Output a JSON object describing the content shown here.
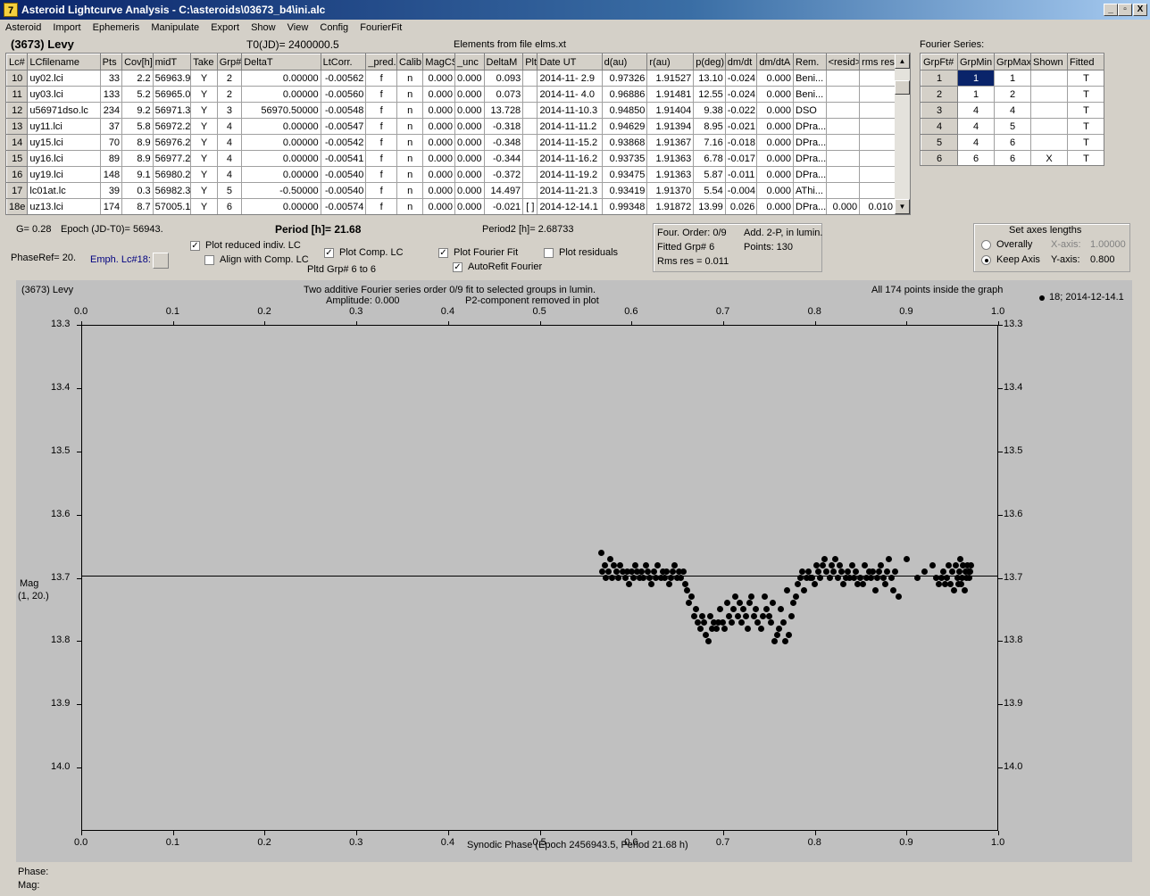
{
  "window": {
    "title": "Asteroid Lightcurve Analysis - C:\\asteroids\\03673_b4\\ini.alc",
    "app_icon": "7",
    "buttons": [
      "_",
      "▫",
      "X"
    ]
  },
  "menu": [
    "Asteroid",
    "Import",
    "Ephemeris",
    "Manipulate",
    "Export",
    "Show",
    "View",
    "Config",
    "FourierFit"
  ],
  "header": {
    "asteroid": "(3673) Levy",
    "t0": "T0(JD)= 2400000.5",
    "elements": "Elements from file elms.xt",
    "fourier_series_label": "Fourier Series:"
  },
  "lc_table": {
    "columns": [
      "Lc#",
      "LCfilename",
      "Pts",
      "Cov[h]",
      "midT",
      "Take",
      "Grp#",
      "DeltaT",
      "LtCorr.",
      "_pred.",
      "Calib.",
      "MagCS",
      "_unc",
      "DeltaM",
      "Plt",
      "Date UT",
      "d(au)",
      "r(au)",
      "p(deg)",
      "dm/dt",
      "dm/dtA",
      "Rem.",
      "<resid>",
      "rms res"
    ],
    "rows": [
      [
        "10",
        "uy02.lci",
        "33",
        "2.2",
        "56963.9",
        "Y",
        "2",
        "0.00000",
        "-0.00562",
        "f",
        "n",
        "0.000",
        "0.000",
        "0.093",
        "",
        "2014-11- 2.9",
        "0.97326",
        "1.91527",
        "13.10",
        "-0.024",
        "0.000",
        "Beni...",
        "",
        ""
      ],
      [
        "11",
        "uy03.lci",
        "133",
        "5.2",
        "56965.0",
        "Y",
        "2",
        "0.00000",
        "-0.00560",
        "f",
        "n",
        "0.000",
        "0.000",
        "0.073",
        "",
        "2014-11- 4.0",
        "0.96886",
        "1.91481",
        "12.55",
        "-0.024",
        "0.000",
        "Beni...",
        "",
        ""
      ],
      [
        "12",
        "u56971dso.lc",
        "234",
        "9.2",
        "56971.3",
        "Y",
        "3",
        "56970.50000",
        "-0.00548",
        "f",
        "n",
        "0.000",
        "0.000",
        "13.728",
        "",
        "2014-11-10.3",
        "0.94850",
        "1.91404",
        "9.38",
        "-0.022",
        "0.000",
        "DSO",
        "",
        ""
      ],
      [
        "13",
        "uy11.lci",
        "37",
        "5.8",
        "56972.2",
        "Y",
        "4",
        "0.00000",
        "-0.00547",
        "f",
        "n",
        "0.000",
        "0.000",
        "-0.318",
        "",
        "2014-11-11.2",
        "0.94629",
        "1.91394",
        "8.95",
        "-0.021",
        "0.000",
        "DPra...",
        "",
        ""
      ],
      [
        "14",
        "uy15.lci",
        "70",
        "8.9",
        "56976.2",
        "Y",
        "4",
        "0.00000",
        "-0.00542",
        "f",
        "n",
        "0.000",
        "0.000",
        "-0.348",
        "",
        "2014-11-15.2",
        "0.93868",
        "1.91367",
        "7.16",
        "-0.018",
        "0.000",
        "DPra...",
        "",
        ""
      ],
      [
        "15",
        "uy16.lci",
        "89",
        "8.9",
        "56977.2",
        "Y",
        "4",
        "0.00000",
        "-0.00541",
        "f",
        "n",
        "0.000",
        "0.000",
        "-0.344",
        "",
        "2014-11-16.2",
        "0.93735",
        "1.91363",
        "6.78",
        "-0.017",
        "0.000",
        "DPra...",
        "",
        ""
      ],
      [
        "16",
        "uy19.lci",
        "148",
        "9.1",
        "56980.2",
        "Y",
        "4",
        "0.00000",
        "-0.00540",
        "f",
        "n",
        "0.000",
        "0.000",
        "-0.372",
        "",
        "2014-11-19.2",
        "0.93475",
        "1.91363",
        "5.87",
        "-0.011",
        "0.000",
        "DPra...",
        "",
        ""
      ],
      [
        "17",
        "lc01at.lc",
        "39",
        "0.3",
        "56982.3",
        "Y",
        "5",
        "-0.50000",
        "-0.00540",
        "f",
        "n",
        "0.000",
        "0.000",
        "14.497",
        "",
        "2014-11-21.3",
        "0.93419",
        "1.91370",
        "5.54",
        "-0.004",
        "0.000",
        "AThi...",
        "",
        ""
      ],
      [
        "18e",
        "uz13.lci",
        "174",
        "8.7",
        "57005.1",
        "Y",
        "6",
        "0.00000",
        "-0.00574",
        "f",
        "n",
        "0.000",
        "0.000",
        "-0.021",
        "[ ]",
        "2014-12-14.1",
        "0.99348",
        "1.91872",
        "13.99",
        "0.026",
        "0.000",
        "DPra...",
        "0.000",
        "0.010"
      ]
    ]
  },
  "fourier_table": {
    "columns": [
      "GrpFt#",
      "GrpMin",
      "GrpMax",
      "Shown",
      "Fitted"
    ],
    "rows": [
      [
        "1",
        "1",
        "1",
        "",
        "T"
      ],
      [
        "2",
        "1",
        "2",
        "",
        "T"
      ],
      [
        "3",
        "4",
        "4",
        "",
        "T"
      ],
      [
        "4",
        "4",
        "5",
        "",
        "T"
      ],
      [
        "5",
        "4",
        "6",
        "",
        "T"
      ],
      [
        "6",
        "6",
        "6",
        "X",
        "T"
      ]
    ]
  },
  "controls": {
    "g": "G= 0.28",
    "epoch": "Epoch (JD-T0)= 56943.",
    "period": "Period [h]= 21.68",
    "period2": "Period2 [h]= 2.68733",
    "phaseref": "PhaseRef= 20.",
    "emph": "Emph. Lc#18:",
    "plot_reduced": "Plot reduced indiv. LC",
    "align_comp": "Align with Comp. LC",
    "plot_comp": "Plot Comp. LC",
    "pltd_grp": "Pltd Grp#  6  to   6",
    "plot_fourier": "Plot Fourier Fit",
    "autorefit": "AutoRefit Fourier",
    "plot_residuals": "Plot residuals",
    "check_state": {
      "plot_reduced": true,
      "align_comp": false,
      "plot_comp": true,
      "plot_fourier": true,
      "autorefit": true,
      "plot_residuals": false
    },
    "four_order": "Four. Order:  0/9",
    "add_2p": "Add. 2-P, in lumin.",
    "fitted_grp": "Fitted Grp# 6",
    "points": "Points: 130",
    "rms_res": "Rms res     = 0.011",
    "axes_title": "Set axes lengths",
    "overally": "Overally",
    "keep_axis": "Keep Axis",
    "x_axis_label": "X-axis:",
    "x_axis_val": "1.00000",
    "y_axis_label": "Y-axis:",
    "y_axis_val": "0.800",
    "axes_mode": "keep_axis"
  },
  "plot_header": {
    "name": "(3673) Levy",
    "line1": "Two additive Fourier series order 0/9 fit to selected groups in lumin.",
    "line2": "Amplitude: 0.000",
    "line3": "P2-component removed in plot",
    "inside": "All 174 points inside the graph",
    "legend": "18; 2014-12-14.1"
  },
  "chart_data": {
    "type": "scatter",
    "title": "Two additive Fourier series order 0/9 fit to selected groups in lumin.",
    "xlabel": "Synodic Phase (Epoch 2456943.5, Period 21.68 h)",
    "ylabel": "Mag\n(1, 20.)",
    "ylabel_line1": "Mag",
    "ylabel_line2": "(1, 20.)",
    "xlim": [
      0.0,
      1.0
    ],
    "ylim": [
      13.3,
      14.1
    ],
    "y_inverted": true,
    "x_ticks": [
      "0.0",
      "0.1",
      "0.2",
      "0.3",
      "0.4",
      "0.5",
      "0.6",
      "0.7",
      "0.8",
      "0.9",
      "1.0"
    ],
    "y_ticks": [
      "13.3",
      "13.4",
      "13.5",
      "13.6",
      "13.7",
      "13.8",
      "13.9",
      "14.0"
    ],
    "fit_line": 13.696,
    "legend": "top-right",
    "series": [
      {
        "name": "18; 2014-12-14.1",
        "x": [
          0.567,
          0.568,
          0.571,
          0.572,
          0.575,
          0.577,
          0.579,
          0.581,
          0.584,
          0.586,
          0.588,
          0.591,
          0.593,
          0.595,
          0.597,
          0.6,
          0.602,
          0.604,
          0.606,
          0.609,
          0.611,
          0.613,
          0.616,
          0.618,
          0.62,
          0.622,
          0.625,
          0.627,
          0.629,
          0.632,
          0.634,
          0.636,
          0.638,
          0.641,
          0.643,
          0.645,
          0.647,
          0.65,
          0.652,
          0.654,
          0.657,
          0.659,
          0.661,
          0.663,
          0.666,
          0.668,
          0.67,
          0.672,
          0.675,
          0.677,
          0.679,
          0.681,
          0.684,
          0.686,
          0.688,
          0.69,
          0.693,
          0.695,
          0.697,
          0.7,
          0.702,
          0.704,
          0.706,
          0.709,
          0.711,
          0.713,
          0.716,
          0.718,
          0.72,
          0.722,
          0.725,
          0.727,
          0.729,
          0.731,
          0.734,
          0.736,
          0.738,
          0.741,
          0.743,
          0.745,
          0.747,
          0.75,
          0.752,
          0.754,
          0.756,
          0.759,
          0.761,
          0.763,
          0.766,
          0.768,
          0.77,
          0.772,
          0.775,
          0.777,
          0.779,
          0.781,
          0.784,
          0.786,
          0.788,
          0.791,
          0.793,
          0.795,
          0.797,
          0.8,
          0.802,
          0.804,
          0.806,
          0.809,
          0.811,
          0.813,
          0.816,
          0.818,
          0.82,
          0.822,
          0.825,
          0.827,
          0.829,
          0.831,
          0.834,
          0.836,
          0.838,
          0.841,
          0.843,
          0.845,
          0.847,
          0.85,
          0.852,
          0.854,
          0.856,
          0.859,
          0.861,
          0.863,
          0.866,
          0.868,
          0.87,
          0.872,
          0.875,
          0.877,
          0.879,
          0.881,
          0.884,
          0.886,
          0.888,
          0.891,
          0.9,
          0.912,
          0.92,
          0.928,
          0.932,
          0.935,
          0.938,
          0.94,
          0.942,
          0.944,
          0.946,
          0.948,
          0.95,
          0.952,
          0.954,
          0.956,
          0.957,
          0.958,
          0.959,
          0.96,
          0.961,
          0.962,
          0.963,
          0.964,
          0.965,
          0.966,
          0.967,
          0.968,
          0.969,
          0.97
        ],
        "y": [
          13.66,
          13.69,
          13.68,
          13.7,
          13.69,
          13.67,
          13.7,
          13.68,
          13.69,
          13.7,
          13.68,
          13.69,
          13.7,
          13.69,
          13.71,
          13.69,
          13.7,
          13.68,
          13.69,
          13.7,
          13.69,
          13.7,
          13.68,
          13.69,
          13.7,
          13.71,
          13.69,
          13.7,
          13.68,
          13.7,
          13.69,
          13.7,
          13.69,
          13.71,
          13.7,
          13.69,
          13.68,
          13.7,
          13.69,
          13.7,
          13.69,
          13.71,
          13.72,
          13.74,
          13.73,
          13.76,
          13.75,
          13.77,
          13.78,
          13.76,
          13.77,
          13.79,
          13.8,
          13.76,
          13.78,
          13.77,
          13.78,
          13.77,
          13.75,
          13.77,
          13.78,
          13.74,
          13.76,
          13.77,
          13.75,
          13.73,
          13.76,
          13.74,
          13.77,
          13.75,
          13.76,
          13.78,
          13.74,
          13.73,
          13.76,
          13.75,
          13.77,
          13.78,
          13.76,
          13.73,
          13.75,
          13.76,
          13.77,
          13.74,
          13.8,
          13.79,
          13.78,
          13.75,
          13.77,
          13.8,
          13.72,
          13.79,
          13.76,
          13.74,
          13.73,
          13.71,
          13.7,
          13.69,
          13.72,
          13.7,
          13.69,
          13.7,
          13.7,
          13.71,
          13.68,
          13.69,
          13.7,
          13.68,
          13.67,
          13.69,
          13.7,
          13.68,
          13.69,
          13.67,
          13.7,
          13.68,
          13.69,
          13.71,
          13.7,
          13.69,
          13.7,
          13.68,
          13.7,
          13.69,
          13.71,
          13.7,
          13.71,
          13.68,
          13.7,
          13.69,
          13.7,
          13.69,
          13.72,
          13.7,
          13.69,
          13.68,
          13.7,
          13.71,
          13.69,
          13.67,
          13.7,
          13.72,
          13.69,
          13.73,
          13.67,
          13.7,
          13.69,
          13.68,
          13.7,
          13.71,
          13.7,
          13.69,
          13.71,
          13.7,
          13.68,
          13.71,
          13.69,
          13.72,
          13.68,
          13.7,
          13.71,
          13.69,
          13.67,
          13.71,
          13.7,
          13.68,
          13.72,
          13.69,
          13.7,
          13.68,
          13.69,
          13.7,
          13.69,
          13.68
        ]
      }
    ]
  },
  "status": {
    "phase": "Phase:",
    "mag": "Mag:"
  }
}
